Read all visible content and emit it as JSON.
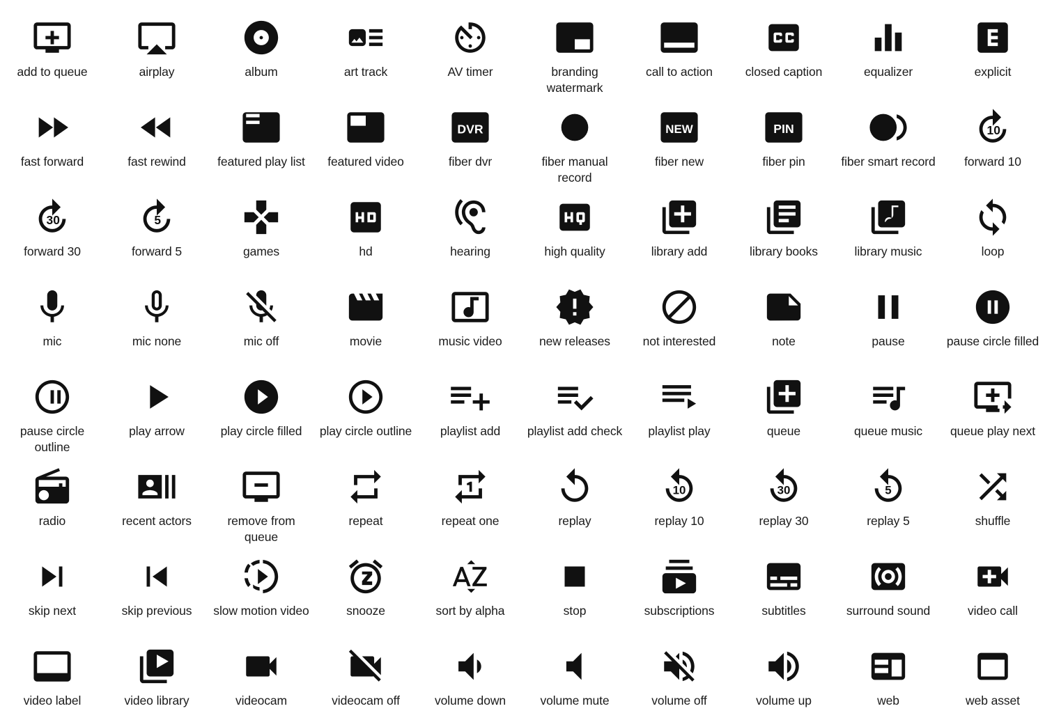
{
  "page": {
    "title": "Material Design AV icon set",
    "columns": 10,
    "rows": 8,
    "total_icons": 80,
    "icon_color": "#111111",
    "background_color": "#ffffff",
    "label_color": "#1b1b1b"
  },
  "icons": [
    {
      "label": "add to queue",
      "name": "add-to-queue-icon"
    },
    {
      "label": "airplay",
      "name": "airplay-icon"
    },
    {
      "label": "album",
      "name": "album-icon"
    },
    {
      "label": "art track",
      "name": "art-track-icon"
    },
    {
      "label": "AV timer",
      "name": "av-timer-icon"
    },
    {
      "label": "branding watermark",
      "name": "branding-watermark-icon"
    },
    {
      "label": "call to action",
      "name": "call-to-action-icon"
    },
    {
      "label": "closed caption",
      "name": "closed-caption-icon",
      "glyph_text": "CC"
    },
    {
      "label": "equalizer",
      "name": "equalizer-icon"
    },
    {
      "label": "explicit",
      "name": "explicit-icon",
      "glyph_text": "E"
    },
    {
      "label": "fast forward",
      "name": "fast-forward-icon"
    },
    {
      "label": "fast rewind",
      "name": "fast-rewind-icon"
    },
    {
      "label": "featured play list",
      "name": "featured-play-list-icon"
    },
    {
      "label": "featured video",
      "name": "featured-video-icon"
    },
    {
      "label": "fiber dvr",
      "name": "fiber-dvr-icon",
      "glyph_text": "DVR"
    },
    {
      "label": "fiber manual record",
      "name": "fiber-manual-record-icon"
    },
    {
      "label": "fiber new",
      "name": "fiber-new-icon",
      "glyph_text": "NEW"
    },
    {
      "label": "fiber pin",
      "name": "fiber-pin-icon",
      "glyph_text": "PIN"
    },
    {
      "label": "fiber smart record",
      "name": "fiber-smart-record-icon"
    },
    {
      "label": "forward 10",
      "name": "forward-10-icon",
      "glyph_text": "10"
    },
    {
      "label": "forward 30",
      "name": "forward-30-icon",
      "glyph_text": "30"
    },
    {
      "label": "forward 5",
      "name": "forward-5-icon",
      "glyph_text": "5"
    },
    {
      "label": "games",
      "name": "games-icon"
    },
    {
      "label": "hd",
      "name": "hd-icon",
      "glyph_text": "HD"
    },
    {
      "label": "hearing",
      "name": "hearing-icon"
    },
    {
      "label": "high quality",
      "name": "high-quality-icon",
      "glyph_text": "HQ"
    },
    {
      "label": "library add",
      "name": "library-add-icon"
    },
    {
      "label": "library books",
      "name": "library-books-icon"
    },
    {
      "label": "library music",
      "name": "library-music-icon"
    },
    {
      "label": "loop",
      "name": "loop-icon"
    },
    {
      "label": "mic",
      "name": "mic-icon"
    },
    {
      "label": "mic none",
      "name": "mic-none-icon"
    },
    {
      "label": "mic off",
      "name": "mic-off-icon"
    },
    {
      "label": "movie",
      "name": "movie-icon"
    },
    {
      "label": "music video",
      "name": "music-video-icon"
    },
    {
      "label": "new releases",
      "name": "new-releases-icon"
    },
    {
      "label": "not interested",
      "name": "not-interested-icon"
    },
    {
      "label": "note",
      "name": "note-icon"
    },
    {
      "label": "pause",
      "name": "pause-icon"
    },
    {
      "label": "pause circle filled",
      "name": "pause-circle-filled-icon"
    },
    {
      "label": "pause circle outline",
      "name": "pause-circle-outline-icon"
    },
    {
      "label": "play arrow",
      "name": "play-arrow-icon"
    },
    {
      "label": "play circle filled",
      "name": "play-circle-filled-icon"
    },
    {
      "label": "play circle outline",
      "name": "play-circle-outline-icon"
    },
    {
      "label": "playlist add",
      "name": "playlist-add-icon"
    },
    {
      "label": "playlist add check",
      "name": "playlist-add-check-icon"
    },
    {
      "label": "playlist play",
      "name": "playlist-play-icon"
    },
    {
      "label": "queue",
      "name": "queue-icon"
    },
    {
      "label": "queue music",
      "name": "queue-music-icon"
    },
    {
      "label": "queue play next",
      "name": "queue-play-next-icon"
    },
    {
      "label": "radio",
      "name": "radio-icon"
    },
    {
      "label": "recent actors",
      "name": "recent-actors-icon"
    },
    {
      "label": "remove from queue",
      "name": "remove-from-queue-icon"
    },
    {
      "label": "repeat",
      "name": "repeat-icon"
    },
    {
      "label": "repeat one",
      "name": "repeat-one-icon",
      "glyph_text": "1"
    },
    {
      "label": "replay",
      "name": "replay-icon"
    },
    {
      "label": "replay 10",
      "name": "replay-10-icon",
      "glyph_text": "10"
    },
    {
      "label": "replay 30",
      "name": "replay-30-icon",
      "glyph_text": "30"
    },
    {
      "label": "replay 5",
      "name": "replay-5-icon",
      "glyph_text": "5"
    },
    {
      "label": "shuffle",
      "name": "shuffle-icon"
    },
    {
      "label": "skip next",
      "name": "skip-next-icon"
    },
    {
      "label": "skip previous",
      "name": "skip-previous-icon"
    },
    {
      "label": "slow motion video",
      "name": "slow-motion-video-icon"
    },
    {
      "label": "snooze",
      "name": "snooze-icon",
      "glyph_text": "Z"
    },
    {
      "label": "sort by alpha",
      "name": "sort-by-alpha-icon",
      "glyph_text": "AZ"
    },
    {
      "label": "stop",
      "name": "stop-icon"
    },
    {
      "label": "subscriptions",
      "name": "subscriptions-icon"
    },
    {
      "label": "subtitles",
      "name": "subtitles-icon"
    },
    {
      "label": "surround sound",
      "name": "surround-sound-icon"
    },
    {
      "label": "video call",
      "name": "video-call-icon"
    },
    {
      "label": "video label",
      "name": "video-label-icon"
    },
    {
      "label": "video library",
      "name": "video-library-icon"
    },
    {
      "label": "videocam",
      "name": "videocam-icon"
    },
    {
      "label": "videocam off",
      "name": "videocam-off-icon"
    },
    {
      "label": "volume down",
      "name": "volume-down-icon"
    },
    {
      "label": "volume mute",
      "name": "volume-mute-icon"
    },
    {
      "label": "volume off",
      "name": "volume-off-icon"
    },
    {
      "label": "volume up",
      "name": "volume-up-icon"
    },
    {
      "label": "web",
      "name": "web-icon"
    },
    {
      "label": "web asset",
      "name": "web-asset-icon"
    }
  ]
}
